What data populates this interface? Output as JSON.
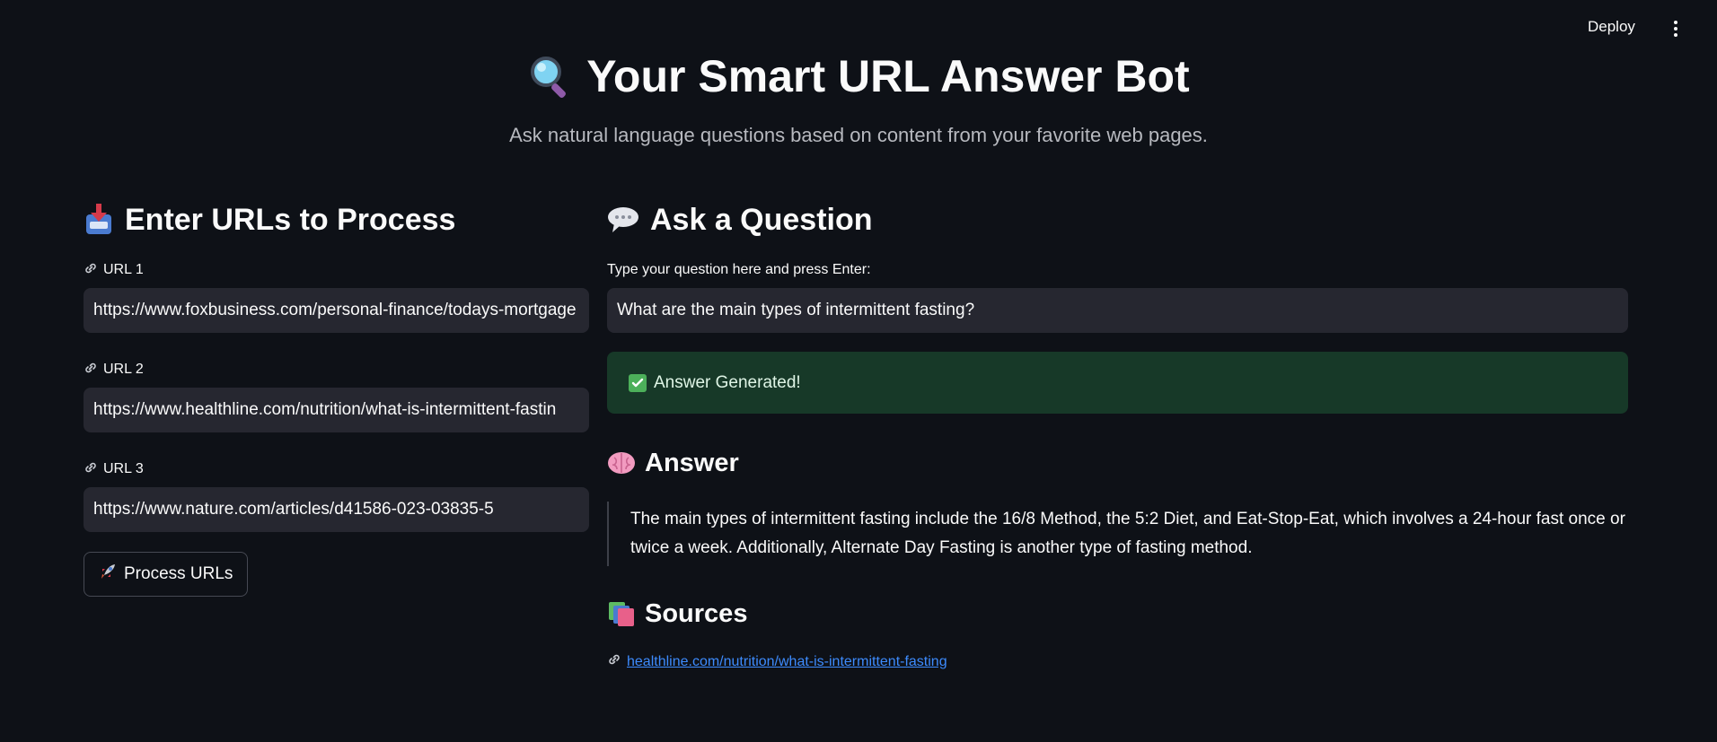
{
  "toolbar": {
    "deploy_label": "Deploy"
  },
  "header": {
    "title": "Your Smart URL Answer Bot",
    "title_icon": "magnifying-glass-icon",
    "subtitle": "Ask natural language questions based on content from your favorite web pages."
  },
  "left": {
    "heading": "Enter URLs to Process",
    "heading_icon": "inbox-tray-icon",
    "urls": [
      {
        "label": "URL 1",
        "value": "https://www.foxbusiness.com/personal-finance/todays-mortgage"
      },
      {
        "label": "URL 2",
        "value": "https://www.healthline.com/nutrition/what-is-intermittent-fastin"
      },
      {
        "label": "URL 3",
        "value": "https://www.nature.com/articles/d41586-023-03835-5"
      }
    ],
    "process_button": "Process URLs",
    "process_icon": "rocket-icon"
  },
  "right": {
    "heading": "Ask a Question",
    "heading_icon": "speech-balloon-icon",
    "question_label": "Type your question here and press Enter:",
    "question_value": "What are the main types of intermittent fasting?",
    "success_text": "Answer Generated!",
    "answer_heading": "Answer",
    "answer_icon": "brain-icon",
    "answer_text": "The main types of intermittent fasting include the 16/8 Method, the 5:2 Diet, and Eat-Stop-Eat, which involves a 24-hour fast once or twice a week. Additionally, Alternate Day Fasting is another type of fasting method.",
    "sources_heading": "Sources",
    "sources_icon": "books-icon",
    "sources": [
      {
        "text": "healthline.com/nutrition/what-is-intermittent-fasting"
      }
    ]
  },
  "colors": {
    "background": "#0e1117",
    "input_bg": "#262730",
    "success_bg": "#173928",
    "link": "#3d8bfd"
  }
}
